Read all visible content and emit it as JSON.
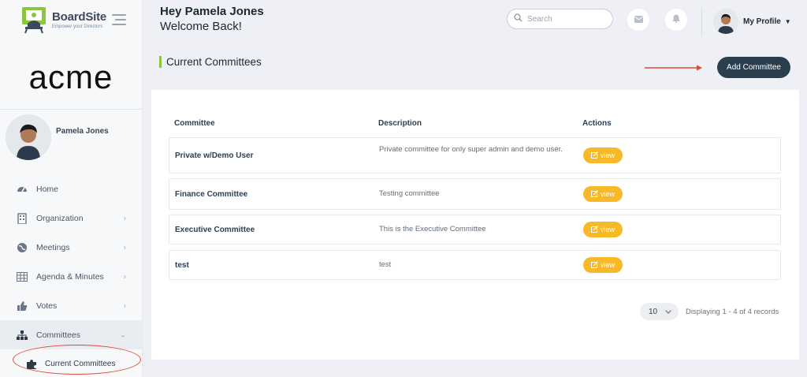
{
  "brand": {
    "name": "BoardSite",
    "tagline": "Empower your Directors"
  },
  "org": {
    "logo_text": "acme"
  },
  "user": {
    "name": "Pamela Jones"
  },
  "sidebar": {
    "items": [
      {
        "label": "Home",
        "icon": "dashboard-icon"
      },
      {
        "label": "Organization",
        "icon": "building-icon"
      },
      {
        "label": "Meetings",
        "icon": "globe-icon"
      },
      {
        "label": "Agenda & Minutes",
        "icon": "table-icon"
      },
      {
        "label": "Votes",
        "icon": "thumbs-up-icon"
      },
      {
        "label": "Committees",
        "icon": "sitemap-icon"
      }
    ],
    "sub_items": [
      {
        "label": "Current Committees",
        "icon": "puzzle-icon"
      }
    ]
  },
  "header": {
    "greeting": "Hey Pamela Jones",
    "welcome": "Welcome Back!",
    "search_placeholder": "Search",
    "profile_label": "My Profile"
  },
  "page": {
    "title": "Current Committees",
    "add_button": "Add Committee"
  },
  "table": {
    "columns": [
      "Committee",
      "Description",
      "Actions"
    ],
    "view_label": "view",
    "rows": [
      {
        "name": "Private w/Demo User",
        "description": "Private committee for only super admin and demo user."
      },
      {
        "name": "Finance Committee",
        "description": "Testing committee"
      },
      {
        "name": "Executive Committee",
        "description": "This is the Executive Committee"
      },
      {
        "name": "test",
        "description": "test"
      }
    ]
  },
  "pagination": {
    "page_size": "10",
    "summary": "Displaying 1 - 4 of 4 records"
  },
  "colors": {
    "accent_green": "#8cc63f",
    "primary_button": "#2b3e4e",
    "view_button": "#f7b928",
    "annotation_red": "#d94c33"
  }
}
